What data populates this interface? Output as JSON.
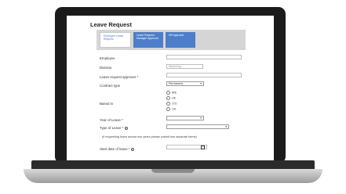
{
  "form": {
    "title": "Leave Request",
    "tabs": [
      {
        "label": "Employee Leave Request"
      },
      {
        "label": "Leave Request Manager Approval"
      },
      {
        "label": "HR Approval"
      }
    ],
    "fields": {
      "employee": {
        "label": "Employee",
        "value": ""
      },
      "division": {
        "label": "Division",
        "value": "Marketing"
      },
      "approver": {
        "label": "Leave request approver *",
        "value": ""
      },
      "contract_type": {
        "label": "Contract type",
        "value": "Permanent"
      },
      "based_in": {
        "label": "Based in",
        "options": [
          "IRE",
          "UK",
          "LTU",
          "US"
        ]
      },
      "year_of_leave": {
        "label": "Year of Leave *",
        "value": ""
      },
      "type_of_leave": {
        "label": "Type of Leave *",
        "value": ""
      },
      "start_date": {
        "label": "Start date of leave *",
        "value": ""
      }
    },
    "note": "(if requesting leave across two years please submit two separate forms)"
  }
}
